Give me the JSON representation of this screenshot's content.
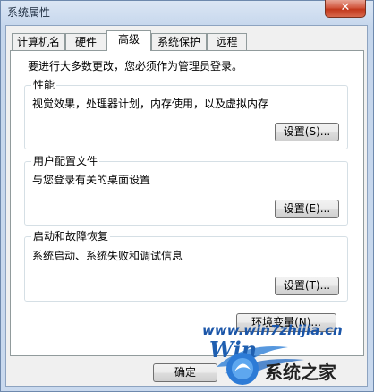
{
  "window": {
    "title": "系统属性",
    "close_glyph": "✕"
  },
  "tabs": [
    {
      "label": "计算机名"
    },
    {
      "label": "硬件"
    },
    {
      "label": "高级"
    },
    {
      "label": "系统保护"
    },
    {
      "label": "远程"
    }
  ],
  "active_tab": "高级",
  "notice": "要进行大多数更改，您必须作为管理员登录。",
  "groups": {
    "performance": {
      "title": "性能",
      "description": "视觉效果，处理器计划，内存使用，以及虚拟内存",
      "button": "设置(S)..."
    },
    "user_profiles": {
      "title": "用户配置文件",
      "description": "与您登录有关的桌面设置",
      "button": "设置(E)..."
    },
    "startup_recovery": {
      "title": "启动和故障恢复",
      "description": "系统启动、系统失败和调试信息",
      "button": "设置(T)..."
    }
  },
  "env_button": "环境变量(N)...",
  "ok_button": "确定",
  "watermark": {
    "url": "www.win7zhijia.cn",
    "brand": "系统之家",
    "logo_text": "Win"
  }
}
